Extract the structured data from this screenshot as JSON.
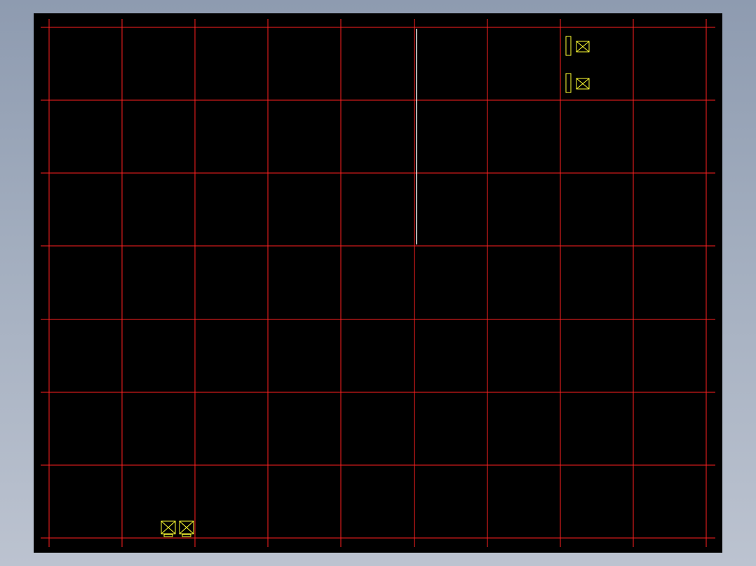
{
  "drawing": {
    "background_color": "#000000",
    "frame_color": "#8e9bb0",
    "grid": {
      "line_color": "#ff2020",
      "columns": 9,
      "rows": 7
    },
    "wall_line_color": "#e8e8e8",
    "symbol_color": "#ffff33",
    "symbols": [
      {
        "kind": "column-with-box-symbol",
        "row": 0,
        "col": 7,
        "position": "upper"
      },
      {
        "kind": "column-with-box-symbol",
        "row": 0,
        "col": 7,
        "position": "lower"
      },
      {
        "kind": "double-box-symbol",
        "row": 6,
        "col": 1,
        "position": "bottom"
      }
    ]
  }
}
